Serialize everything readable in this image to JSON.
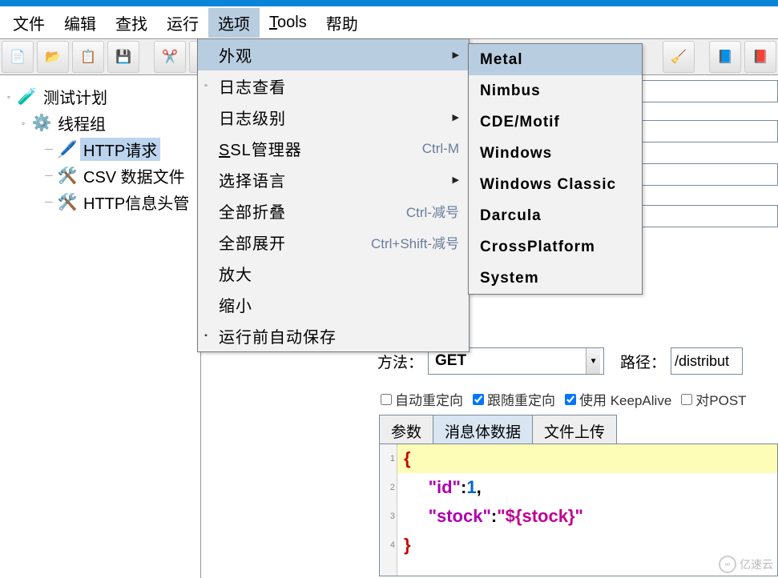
{
  "menubar": {
    "file": "文件",
    "edit": "编辑",
    "search": "查找",
    "run": "运行",
    "options": "选项",
    "tools": "Tools",
    "help": "帮助"
  },
  "toolbar_icons": {
    "new": "📄",
    "open": "📂",
    "save_template": "📋",
    "save": "💾",
    "cut": "✂️",
    "copy": "📄",
    "broom": "🧹",
    "book": "📘",
    "help": "📕"
  },
  "tree": {
    "plan": "测试计划",
    "group": "线程组",
    "http": "HTTP请求",
    "csv": "CSV 数据文件",
    "header": "HTTP信息头管"
  },
  "options_menu": {
    "look_feel": "外观",
    "log_viewer": "日志查看",
    "log_level": "日志级别",
    "ssl_mgr_prefix": "S",
    "ssl_mgr_rest": "SL管理器",
    "ssl_sc": "Ctrl-M",
    "choose_lang": "选择语言",
    "collapse_all": "全部折叠",
    "collapse_sc": "Ctrl-减号",
    "expand_all": "全部展开",
    "expand_sc": "Ctrl+Shift-减号",
    "zoom_in": "放大",
    "zoom_out": "缩小",
    "autosave": "运行前自动保存"
  },
  "laf_menu": {
    "metal": "Metal",
    "nimbus": "Nimbus",
    "cde": "CDE/Motif",
    "windows": "Windows",
    "winclassic": "Windows Classic",
    "darcula": "Darcula",
    "cross": "CrossPlatform",
    "system": "System"
  },
  "form": {
    "method_label": "方法：",
    "method_value": "GET",
    "path_label": "路径：",
    "path_value": "/distribut"
  },
  "checks": {
    "auto_redirect": "自动重定向",
    "follow_redirect": "跟随重定向",
    "keepalive": "使用 KeepAlive",
    "post": "对POST"
  },
  "tabs": {
    "params": "参数",
    "body": "消息体数据",
    "upload": "文件上传"
  },
  "code": {
    "ln1": "1",
    "ln2": "2",
    "ln3": "3",
    "ln4": "4",
    "brace_open": "{",
    "brace_close": "}",
    "key_id": "\"id\"",
    "colon": ":",
    "val_id": "1",
    "comma": ",",
    "key_stock": "\"stock\"",
    "val_stock": "\"${stock}\""
  },
  "watermark": "亿速云"
}
